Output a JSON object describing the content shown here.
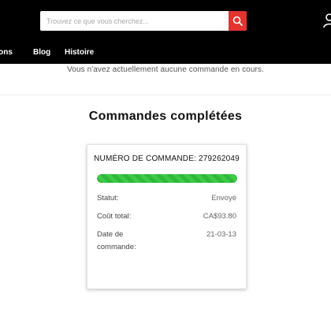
{
  "header": {
    "search": {
      "placeholder": "Trouvez ce que vous cherchez...",
      "value": ""
    },
    "search_button_icon": "search-icon",
    "user_icon": "user-icon",
    "nav": [
      {
        "label": "tions"
      },
      {
        "label": "Blog"
      },
      {
        "label": "Histoire"
      }
    ]
  },
  "current_orders": {
    "message": "Vous n'avez actuellement aucune commande en cours."
  },
  "completed_orders": {
    "title": "Commandes complétées",
    "orders": [
      {
        "header": "NUMÉRO DE COMMANDE: 279262049",
        "progress_percent": 100,
        "status_label": "Statut:",
        "status_value": "Envoyé",
        "total_label": "Coût total:",
        "total_value": "CA$93.80",
        "date_label": "Date de commande:",
        "date_value": "21-03-13"
      }
    ]
  },
  "colors": {
    "header_bg": "#000000",
    "search_button": "#e4342f",
    "progress": "#2fb83a"
  }
}
